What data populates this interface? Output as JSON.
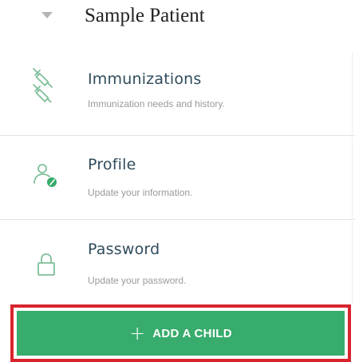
{
  "header": {
    "patient_name": "Sample Patient"
  },
  "menu": {
    "items": [
      {
        "title": "Immunizations",
        "subtitle": "Immunization needs and history.",
        "icon": "syringe-icon"
      },
      {
        "title": "Profile",
        "subtitle": "Update your information.",
        "icon": "user-edit-icon"
      },
      {
        "title": "Password",
        "subtitle": "Update your password.",
        "icon": "lock-icon"
      }
    ]
  },
  "actions": {
    "add_child_plus": "+",
    "add_child_label": "ADD A CHILD"
  },
  "colors": {
    "accent_green": "#37ac6c",
    "highlight_red": "#d8252d",
    "icon_green": "#7fbf98",
    "title_text": "#2f4c5c"
  }
}
